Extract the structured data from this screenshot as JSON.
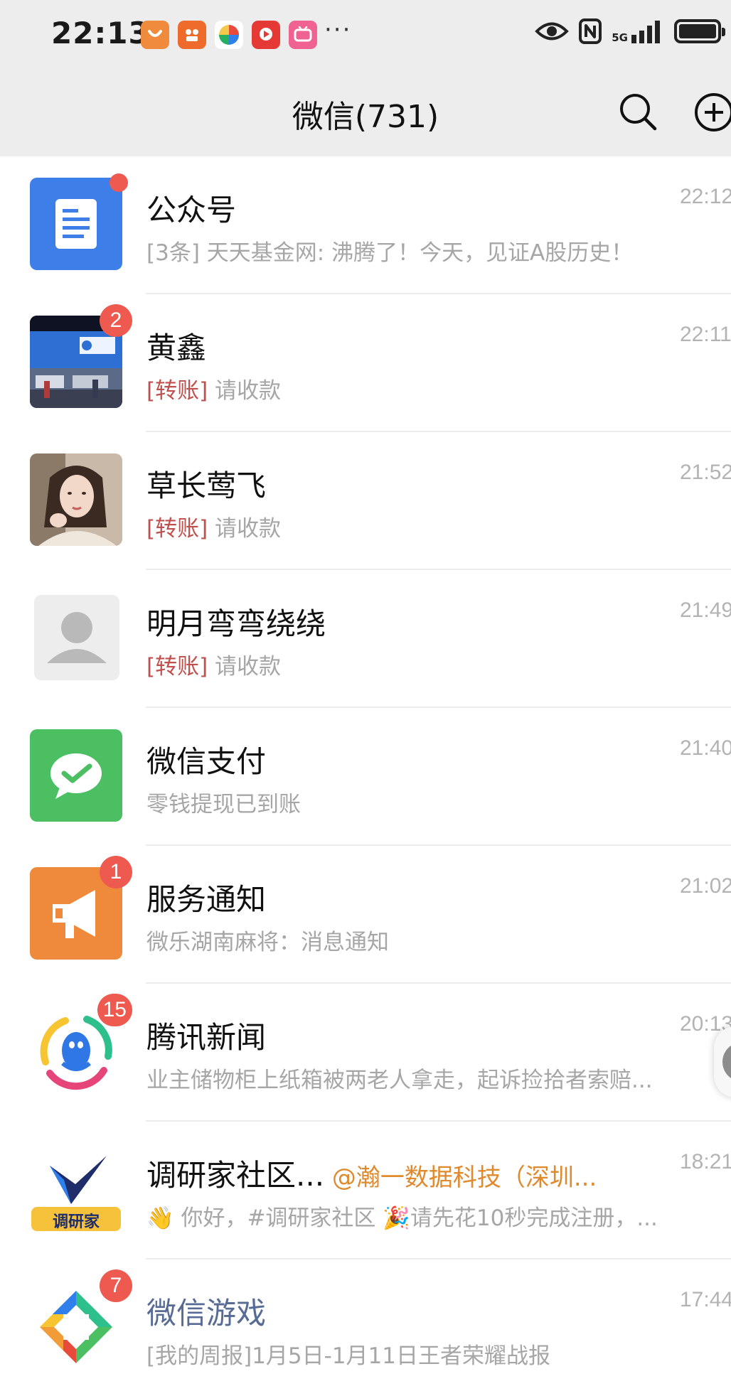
{
  "status_bar": {
    "time": "22:13",
    "app_icons": [
      "taobao-icon",
      "video-app-icon",
      "colorful-app-icon",
      "video-red-icon",
      "bilibili-icon"
    ],
    "more": "···",
    "network": "5G"
  },
  "nav": {
    "title": "微信(731)",
    "search_icon": "search-icon",
    "add_icon": "add-circle-icon"
  },
  "colors": {
    "header_bg": "#ededed",
    "badge": "#ee5a50",
    "tag": "#c0504d",
    "mention": "#e08a2e",
    "game_name": "#576b95"
  },
  "chats": [
    {
      "name": "公众号",
      "preview": "[3条] 天天基金网: 沸腾了！今天，见证A股历史！",
      "time": "22:12",
      "badge_dot": true,
      "avatar_icon": "official-accounts-icon"
    },
    {
      "name": "黄鑫",
      "preview_tag": "[转账]",
      "preview": " 请收款",
      "time": "22:11",
      "badge": "2",
      "avatar_icon": "photo-avatar"
    },
    {
      "name": "草长莺飞",
      "preview_tag": "[转账]",
      "preview": " 请收款",
      "time": "21:52",
      "avatar_icon": "photo-avatar"
    },
    {
      "name": "明月弯弯绕绕",
      "preview_tag": "[转账]",
      "preview": " 请收款",
      "time": "21:49",
      "avatar_icon": "default-person-avatar"
    },
    {
      "name": "微信支付",
      "preview": "零钱提现已到账",
      "time": "21:40",
      "avatar_icon": "wechat-pay-icon"
    },
    {
      "name": "服务通知",
      "preview": "微乐湖南麻将：消息通知",
      "time": "21:02",
      "badge": "1",
      "avatar_icon": "megaphone-icon"
    },
    {
      "name": "腾讯新闻",
      "preview": "业主储物柜上纸箱被两老人拿走，起诉捡拾者索赔...",
      "time": "20:13",
      "badge": "15",
      "avatar_icon": "tencent-news-icon"
    },
    {
      "name": "调研家社区...",
      "name_mention": " @瀚一数据科技（深圳...",
      "preview": "👋 你好，#调研家社区 🎉请先花10秒完成注册，...",
      "time": "18:21",
      "avatar_icon": "diaoyanjia-logo",
      "avatar_text": "调研家"
    },
    {
      "name": "微信游戏",
      "preview": "[我的周报]1月5日-1月11日王者荣耀战报",
      "time": "17:44",
      "badge": "7",
      "avatar_icon": "wechat-game-icon"
    }
  ]
}
